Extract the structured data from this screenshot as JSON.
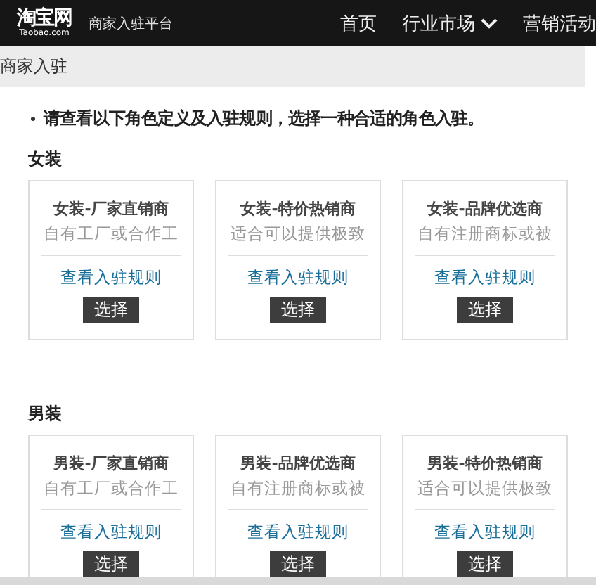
{
  "header": {
    "logo": "淘宝网",
    "logo_sub": "Taobao.com",
    "platform": "商家入驻平台",
    "nav": [
      {
        "label": "首页",
        "dropdown": false
      },
      {
        "label": "行业市场",
        "dropdown": true
      },
      {
        "label": "营销活动",
        "dropdown": false
      }
    ]
  },
  "breadcrumb": "商家入驻",
  "notice": "请查看以下角色定义及入驻规则，选择一种合适的角色入驻。",
  "sections": [
    {
      "title": "女装",
      "cards": [
        {
          "title": "女装-厂家直销商",
          "desc": "自有工厂或合作工",
          "link": "查看入驻规则",
          "button": "选择"
        },
        {
          "title": "女装-特价热销商",
          "desc": "适合可以提供极致",
          "link": "查看入驻规则",
          "button": "选择"
        },
        {
          "title": "女装-品牌优选商",
          "desc": "自有注册商标或被",
          "link": "查看入驻规则",
          "button": "选择"
        }
      ]
    },
    {
      "title": "男装",
      "cards": [
        {
          "title": "男装-厂家直销商",
          "desc": "自有工厂或合作工",
          "link": "查看入驻规则",
          "button": "选择"
        },
        {
          "title": "男装-品牌优选商",
          "desc": "自有注册商标或被",
          "link": "查看入驻规则",
          "button": "选择"
        },
        {
          "title": "男装-特价热销商",
          "desc": "适合可以提供极致",
          "link": "查看入驻规则",
          "button": "选择"
        }
      ]
    }
  ]
}
